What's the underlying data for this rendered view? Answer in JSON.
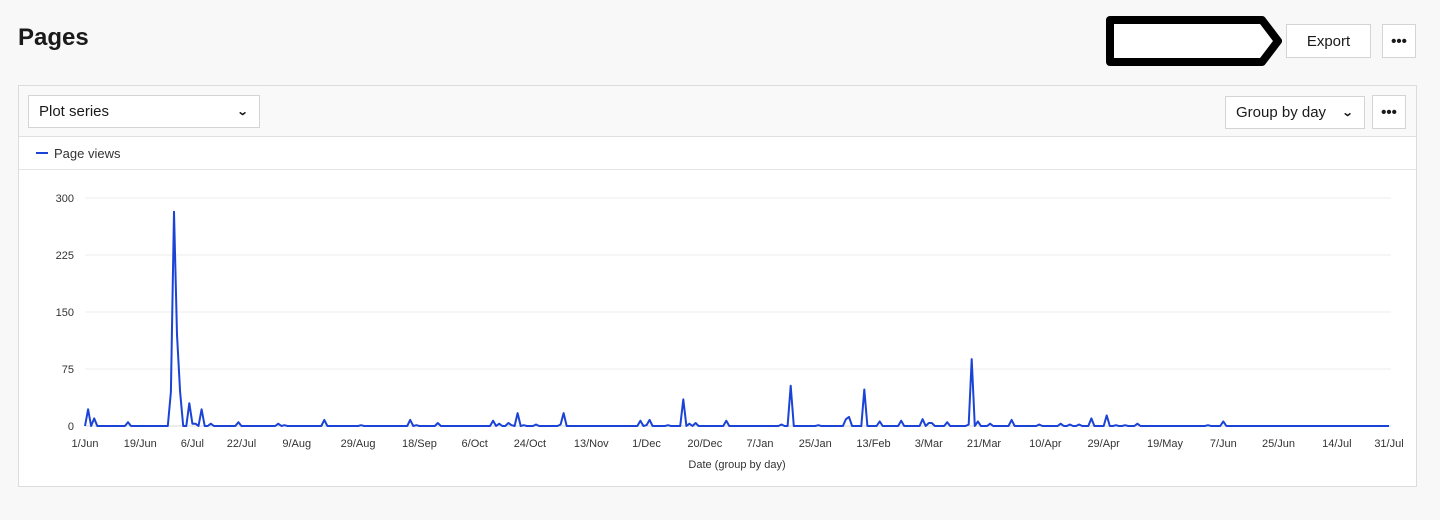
{
  "page": {
    "title": "Pages"
  },
  "header": {
    "export_label": "Export",
    "more_icon": "ellipsis-icon"
  },
  "toolbar": {
    "series_select": {
      "value": "Plot series",
      "icon": "chevron-down-icon"
    },
    "group_select": {
      "value": "Group by day",
      "icon": "chevron-down-icon"
    },
    "more_icon": "ellipsis-icon"
  },
  "colors": {
    "series": "#1b44d6",
    "grid": "#ececec",
    "axis_text": "#333333"
  },
  "chart_data": {
    "type": "line",
    "title": "",
    "xlabel": "Date (group by day)",
    "ylabel": "",
    "ylim": [
      0,
      300
    ],
    "yticks": [
      0,
      75,
      150,
      225,
      300
    ],
    "grid": true,
    "legend": {
      "position": "top-left",
      "entries": [
        "Page views"
      ]
    },
    "x_range_days": [
      0,
      425
    ],
    "x_start": "1/Jun",
    "x_end": "31/Jul",
    "xtick_labels": [
      "1/Jun",
      "19/Jun",
      "6/Jul",
      "22/Jul",
      "9/Aug",
      "29/Aug",
      "18/Sep",
      "6/Oct",
      "24/Oct",
      "13/Nov",
      "1/Dec",
      "20/Dec",
      "7/Jan",
      "25/Jan",
      "13/Feb",
      "3/Mar",
      "21/Mar",
      "10/Apr",
      "29/Apr",
      "19/May",
      "7/Jun",
      "25/Jun",
      "14/Jul",
      "31/Jul"
    ],
    "xtick_days": [
      0,
      18,
      35,
      51,
      69,
      89,
      109,
      127,
      145,
      165,
      183,
      202,
      220,
      238,
      257,
      275,
      293,
      313,
      332,
      352,
      371,
      389,
      408,
      425
    ],
    "series": [
      {
        "name": "Page views",
        "note": "daily values; days not listed are 0",
        "points": [
          [
            1,
            22
          ],
          [
            3,
            10
          ],
          [
            14,
            5
          ],
          [
            28,
            45
          ],
          [
            29,
            282
          ],
          [
            30,
            120
          ],
          [
            31,
            45
          ],
          [
            34,
            30
          ],
          [
            35,
            3
          ],
          [
            36,
            3
          ],
          [
            38,
            22
          ],
          [
            41,
            3
          ],
          [
            50,
            5
          ],
          [
            63,
            3
          ],
          [
            65,
            1
          ],
          [
            78,
            8
          ],
          [
            90,
            1
          ],
          [
            106,
            8
          ],
          [
            108,
            1
          ],
          [
            115,
            4
          ],
          [
            133,
            7
          ],
          [
            135,
            3
          ],
          [
            138,
            4
          ],
          [
            139,
            1
          ],
          [
            141,
            17
          ],
          [
            143,
            1
          ],
          [
            147,
            2
          ],
          [
            155,
            2
          ],
          [
            156,
            17
          ],
          [
            181,
            7
          ],
          [
            183,
            1
          ],
          [
            184,
            8
          ],
          [
            190,
            1
          ],
          [
            195,
            35
          ],
          [
            197,
            3
          ],
          [
            199,
            4
          ],
          [
            209,
            7
          ],
          [
            227,
            2
          ],
          [
            230,
            53
          ],
          [
            239,
            1
          ],
          [
            248,
            9
          ],
          [
            249,
            12
          ],
          [
            254,
            48
          ],
          [
            259,
            6
          ],
          [
            266,
            7
          ],
          [
            273,
            9
          ],
          [
            275,
            4
          ],
          [
            276,
            4
          ],
          [
            281,
            5
          ],
          [
            288,
            2
          ],
          [
            289,
            88
          ],
          [
            291,
            6
          ],
          [
            295,
            3
          ],
          [
            302,
            8
          ],
          [
            311,
            2
          ],
          [
            318,
            3
          ],
          [
            321,
            2
          ],
          [
            324,
            2
          ],
          [
            328,
            10
          ],
          [
            333,
            14
          ],
          [
            336,
            1
          ],
          [
            339,
            1
          ],
          [
            343,
            3
          ],
          [
            366,
            1
          ],
          [
            371,
            6
          ]
        ]
      }
    ]
  }
}
